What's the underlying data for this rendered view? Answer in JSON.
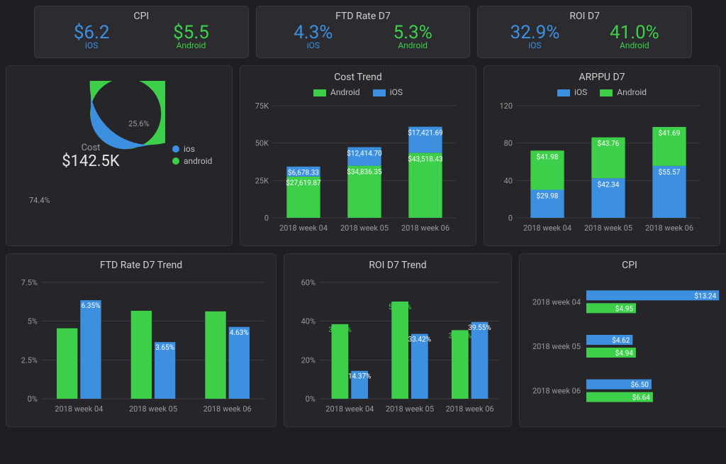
{
  "colors": {
    "ios": "#3d90df",
    "android": "#3ecf4a"
  },
  "kpi": [
    {
      "title": "CPI",
      "ios": "$6.2",
      "android": "$5.5",
      "ios_sub": "iOS",
      "android_sub": "Android"
    },
    {
      "title": "FTD Rate D7",
      "ios": "4.3%",
      "android": "5.3%",
      "ios_sub": "iOS",
      "android_sub": "Android"
    },
    {
      "title": "ROI D7",
      "ios": "32.9%",
      "android": "41.0%",
      "ios_sub": "iOS",
      "android_sub": "Android"
    }
  ],
  "donut": {
    "title": "Cost",
    "total": "$142.5K",
    "slices": [
      {
        "name": "ios",
        "pct": 25.6,
        "label": "25.6%"
      },
      {
        "name": "android",
        "pct": 74.4,
        "label": "74.4%"
      }
    ],
    "legend": [
      "ios",
      "android"
    ]
  },
  "chart_data": [
    {
      "id": "cost_trend",
      "type": "bar",
      "stacked": true,
      "title": "Cost Trend",
      "legend": [
        "Android",
        "iOS"
      ],
      "categories": [
        "2018 week 04",
        "2018 week 05",
        "2018 week 06"
      ],
      "series": [
        {
          "name": "Android",
          "values": [
            27619.87,
            34836.35,
            43518.43
          ],
          "labels": [
            "$27,619.87",
            "$34,836.35",
            "$43,518.43"
          ]
        },
        {
          "name": "iOS",
          "values": [
            6678.33,
            12414.7,
            17421.69
          ],
          "labels": [
            "$6,678.33",
            "$12,414.70",
            "$17,421.69"
          ]
        }
      ],
      "y_ticks": [
        0,
        "25K",
        "50K",
        "75K"
      ],
      "ylim": [
        0,
        75000
      ]
    },
    {
      "id": "arppu_d7",
      "type": "bar",
      "stacked": true,
      "title": "ARPPU D7",
      "legend": [
        "iOS",
        "Android"
      ],
      "categories": [
        "2018 week 04",
        "2018 week 05",
        "2018 week 06"
      ],
      "series": [
        {
          "name": "iOS",
          "values": [
            29.98,
            42.34,
            55.57
          ],
          "labels": [
            "$29.98",
            "$42.34",
            "$55.57"
          ]
        },
        {
          "name": "Android",
          "values": [
            41.98,
            43.76,
            41.69
          ],
          "labels": [
            "$41.98",
            "$43.76",
            "$41.69"
          ]
        }
      ],
      "y_ticks": [
        0,
        40,
        80,
        120
      ],
      "ylim": [
        0,
        120
      ]
    },
    {
      "id": "ftd_rate_d7_trend",
      "type": "bar",
      "grouped": true,
      "title": "FTD Rate D7 Trend",
      "categories": [
        "2018 week 04",
        "2018 week 05",
        "2018 week 06"
      ],
      "series": [
        {
          "name": "Android",
          "values": [
            4.54,
            5.67,
            5.63
          ],
          "labels": [
            "4.54%",
            "5.67%",
            "5.63%"
          ]
        },
        {
          "name": "iOS",
          "values": [
            6.35,
            3.65,
            4.63
          ],
          "labels": [
            "6.35%",
            "3.65%",
            "4.63%"
          ]
        }
      ],
      "y_ticks": [
        "0%",
        "2.5%",
        "5%",
        "7.5%"
      ],
      "ylim": [
        0,
        7.5
      ]
    },
    {
      "id": "roi_d7_trend",
      "type": "bar",
      "grouped": true,
      "title": "ROI D7 Trend",
      "categories": [
        "2018 week 04",
        "2018 week 05",
        "2018 week 06"
      ],
      "series": [
        {
          "name": "Android",
          "values": [
            38.45,
            50.12,
            35.35
          ],
          "labels": [
            "38.45%",
            "50.12%",
            "35.35%"
          ]
        },
        {
          "name": "iOS",
          "values": [
            14.37,
            33.42,
            39.55
          ],
          "labels": [
            "14.37%",
            "33.42%",
            "39.55%"
          ]
        }
      ],
      "y_ticks": [
        "0%",
        "20%",
        "40%",
        "60%"
      ],
      "ylim": [
        0,
        60
      ]
    },
    {
      "id": "cpi",
      "type": "bar",
      "horizontal": true,
      "title": "CPI",
      "categories": [
        "2018 week 04",
        "2018 week 05",
        "2018 week 06"
      ],
      "series": [
        {
          "name": "iOS",
          "values": [
            13.24,
            4.62,
            6.5
          ],
          "labels": [
            "$13.24",
            "$4.62",
            "$6.50"
          ]
        },
        {
          "name": "Android",
          "values": [
            4.95,
            4.94,
            6.64
          ],
          "labels": [
            "$4.95",
            "$4.94",
            "$6.64"
          ]
        }
      ],
      "xlim": [
        0,
        14
      ]
    }
  ]
}
